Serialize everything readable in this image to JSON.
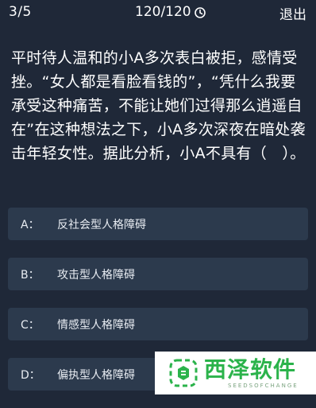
{
  "header": {
    "progress": "3/5",
    "timer": "120/120",
    "timer_icon": "clock-icon",
    "exit_label": "退出"
  },
  "question": {
    "text": "平时待人温和的小A多次表白被拒，感情受挫。“女人都是看脸看钱的”，“凭什么我要承受这种痛苦，不能让她们过得那么逍遥自在”在这种想法之下，小A多次深夜在暗处袭击年轻女性。据此分析，小A不具有（　）。"
  },
  "options": [
    {
      "key": "A：",
      "text": "反社会型人格障碍"
    },
    {
      "key": "B：",
      "text": "攻击型人格障碍"
    },
    {
      "key": "C：",
      "text": "情感型人格障碍"
    },
    {
      "key": "D：",
      "text": "偏执型人格障碍"
    }
  ],
  "watermark": {
    "title": "西泽软件",
    "subtitle": "SEEDSOFCHANGE",
    "brand_color": "#2bb34b"
  },
  "colors": {
    "background": "#1f2838",
    "option_bg": "#2c3a4d",
    "text": "#ffffff"
  }
}
